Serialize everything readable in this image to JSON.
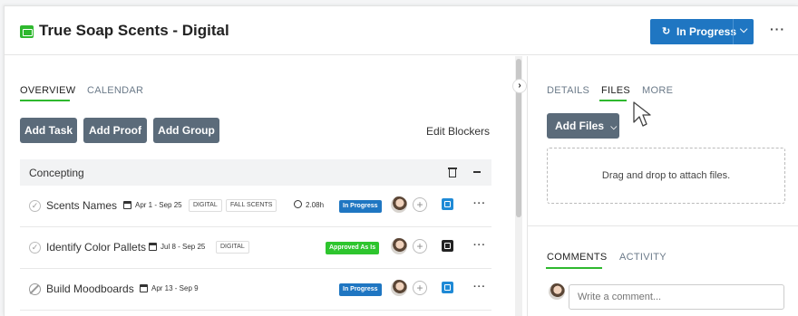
{
  "header": {
    "title": "True Soap Scents - Digital",
    "status_label": "In Progress",
    "status_icon": "refresh-icon",
    "more_label": "···",
    "brand_color": "#2eb82e",
    "status_color": "#1f76c2"
  },
  "left": {
    "tabs": [
      {
        "label": "OVERVIEW",
        "active": true
      },
      {
        "label": "CALENDAR",
        "active": false
      }
    ],
    "buttons": [
      "Add Task",
      "Add Proof",
      "Add Group"
    ],
    "edit_blockers": "Edit Blockers",
    "group": {
      "name": "Concepting"
    },
    "tasks": [
      {
        "name": "Scents Names",
        "date": "Apr 1 - Sep 25",
        "tags": [
          "DIGITAL",
          "FALL SCENTS"
        ],
        "time": "2.08h",
        "status": "In Progress",
        "status_color": "#1f76c2",
        "action_color": "blue",
        "completed_state": "check"
      },
      {
        "name": "Identify Color Pallets",
        "date": "Jul 8 - Sep 25",
        "tags": [
          "DIGITAL"
        ],
        "status": "Approved As Is",
        "status_color": "#2ec52e",
        "action_color": "dark",
        "completed_state": "check"
      },
      {
        "name": "Build Moodboards",
        "date": "Apr 13 - Sep 9",
        "tags": [],
        "status": "In Progress",
        "status_color": "#1f76c2",
        "action_color": "blue",
        "completed_state": "blocked"
      }
    ],
    "row_more": "···"
  },
  "right": {
    "tabs": [
      {
        "label": "DETAILS",
        "active": false
      },
      {
        "label": "FILES",
        "active": true
      },
      {
        "label": "MORE",
        "active": false
      }
    ],
    "add_files_label": "Add Files",
    "dropzone_text": "Drag and drop to attach files.",
    "bottom_tabs": [
      {
        "label": "COMMENTS",
        "active": true
      },
      {
        "label": "ACTIVITY",
        "active": false
      }
    ],
    "comment_placeholder": "Write a comment..."
  }
}
